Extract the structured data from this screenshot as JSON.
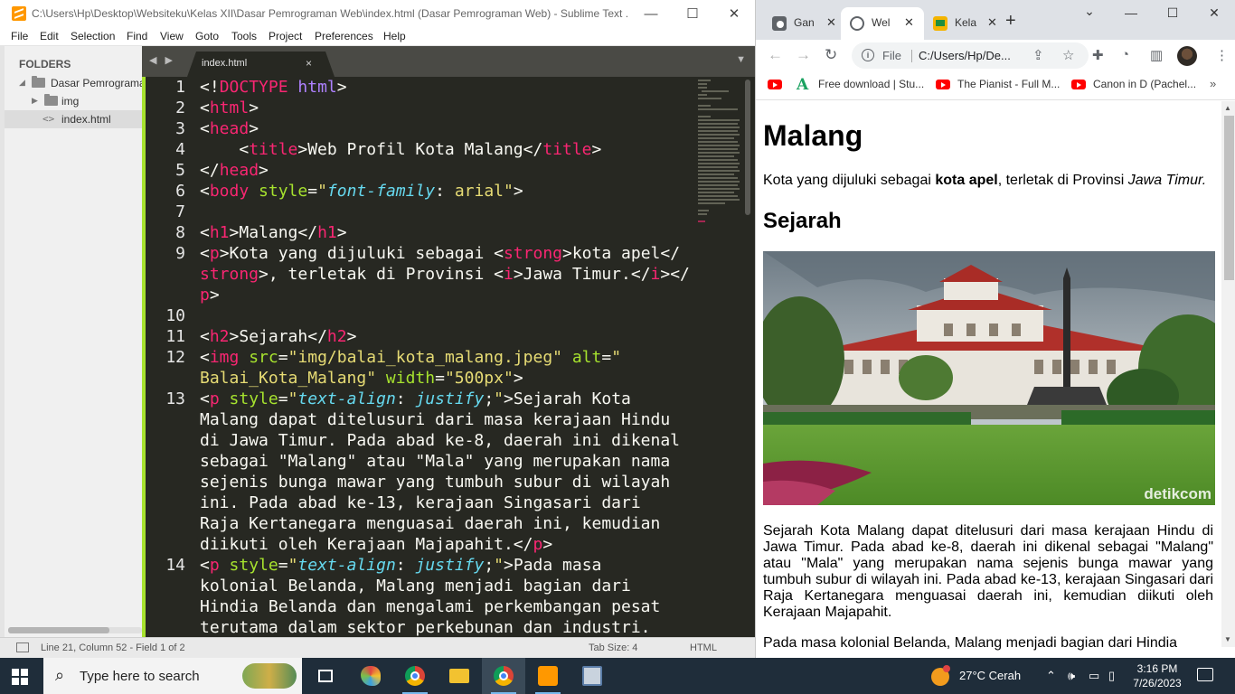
{
  "sublime": {
    "title": "C:\\Users\\Hp\\Desktop\\Websiteku\\Kelas XII\\Dasar Pemrograman Web\\index.html (Dasar Pemrograman Web) - Sublime Text ...",
    "window_controls": {
      "minimize": "—",
      "maximize": "☐",
      "close": "✕"
    },
    "menu": [
      "File",
      "Edit",
      "Selection",
      "Find",
      "View",
      "Goto",
      "Tools",
      "Project",
      "Preferences",
      "Help"
    ],
    "sidebar": {
      "header": "FOLDERS",
      "items": [
        {
          "label": "Dasar Pemrograma",
          "type": "folder-open",
          "arrow": "◢"
        },
        {
          "label": "img",
          "type": "folder",
          "arrow": "▶"
        },
        {
          "label": "index.html",
          "type": "file",
          "icon": "<>"
        }
      ]
    },
    "tab": {
      "label": "index.html",
      "close": "×",
      "nav": "◀ ▶",
      "dropdown": "▼"
    },
    "line_numbers": [
      "1",
      "2",
      "3",
      "4",
      "5",
      "6",
      "7",
      "8",
      "9",
      "",
      "",
      "10",
      "11",
      "12",
      "",
      "13",
      "",
      "",
      "",
      "",
      "",
      "",
      "",
      "14",
      "",
      "",
      ""
    ],
    "status": {
      "position": "Line 21, Column 52 - Field 1 of 2",
      "tab_size": "Tab Size: 4",
      "syntax": "HTML"
    }
  },
  "chrome": {
    "tabs": [
      {
        "label": "Gan",
        "favicon": "google-classroom-icon",
        "close": "✕"
      },
      {
        "label": "Wel",
        "favicon": "globe-icon",
        "close": "✕"
      },
      {
        "label": "Kela",
        "favicon": "google-classroom-icon",
        "close": "✕"
      }
    ],
    "new_tab": "+",
    "tab_search": "⌄",
    "window_controls": {
      "minimize": "—",
      "maximize": "☐",
      "close": "✕"
    },
    "omnibox": {
      "scheme_label": "File",
      "url": "C:/Users/Hp/De..."
    },
    "bookmarks": [
      {
        "label": "Free download | Stu...",
        "icon": "arrow-a-icon"
      },
      {
        "label": "The Pianist - Full M...",
        "icon": "youtube-icon"
      },
      {
        "label": "Canon in D (Pachel...",
        "icon": "youtube-icon"
      }
    ],
    "bookmarks_more": "»",
    "page": {
      "h1": "Malang",
      "intro_before": "Kota yang dijuluki sebagai ",
      "intro_strong": "kota apel",
      "intro_mid": ", terletak di Provinsi ",
      "intro_italic": "Jawa Timur.",
      "h2": "Sejarah",
      "image_credit": "detikcom",
      "para1": "Sejarah Kota Malang dapat ditelusuri dari masa kerajaan Hindu di Jawa Timur. Pada abad ke-8, daerah ini dikenal sebagai \"Malang\" atau \"Mala\" yang merupakan nama sejenis bunga mawar yang tumbuh subur di wilayah ini. Pada abad ke-13, kerajaan Singasari dari Raja Kertanegara menguasai daerah ini, kemudian diikuti oleh Kerajaan Majapahit.",
      "para2": "Pada masa kolonial Belanda, Malang menjadi bagian dari Hindia"
    }
  },
  "taskbar": {
    "search_placeholder": "Type here to search",
    "apps": [
      "task-view-icon",
      "paint-icon",
      "chrome-icon",
      "file-explorer-icon",
      "chrome-profile-icon",
      "sublime-text-icon",
      "remote-desktop-icon"
    ],
    "weather": "27°C  Cerah",
    "tray_chevron": "⌃",
    "time": "3:16 PM",
    "date": "7/26/2023"
  },
  "colors": {
    "monokai_bg": "#272822",
    "tag": "#f92672",
    "attr": "#a6e22e",
    "string": "#e6db74",
    "prop": "#66d9ef",
    "taskbar_bg": "#1f2d3a"
  }
}
